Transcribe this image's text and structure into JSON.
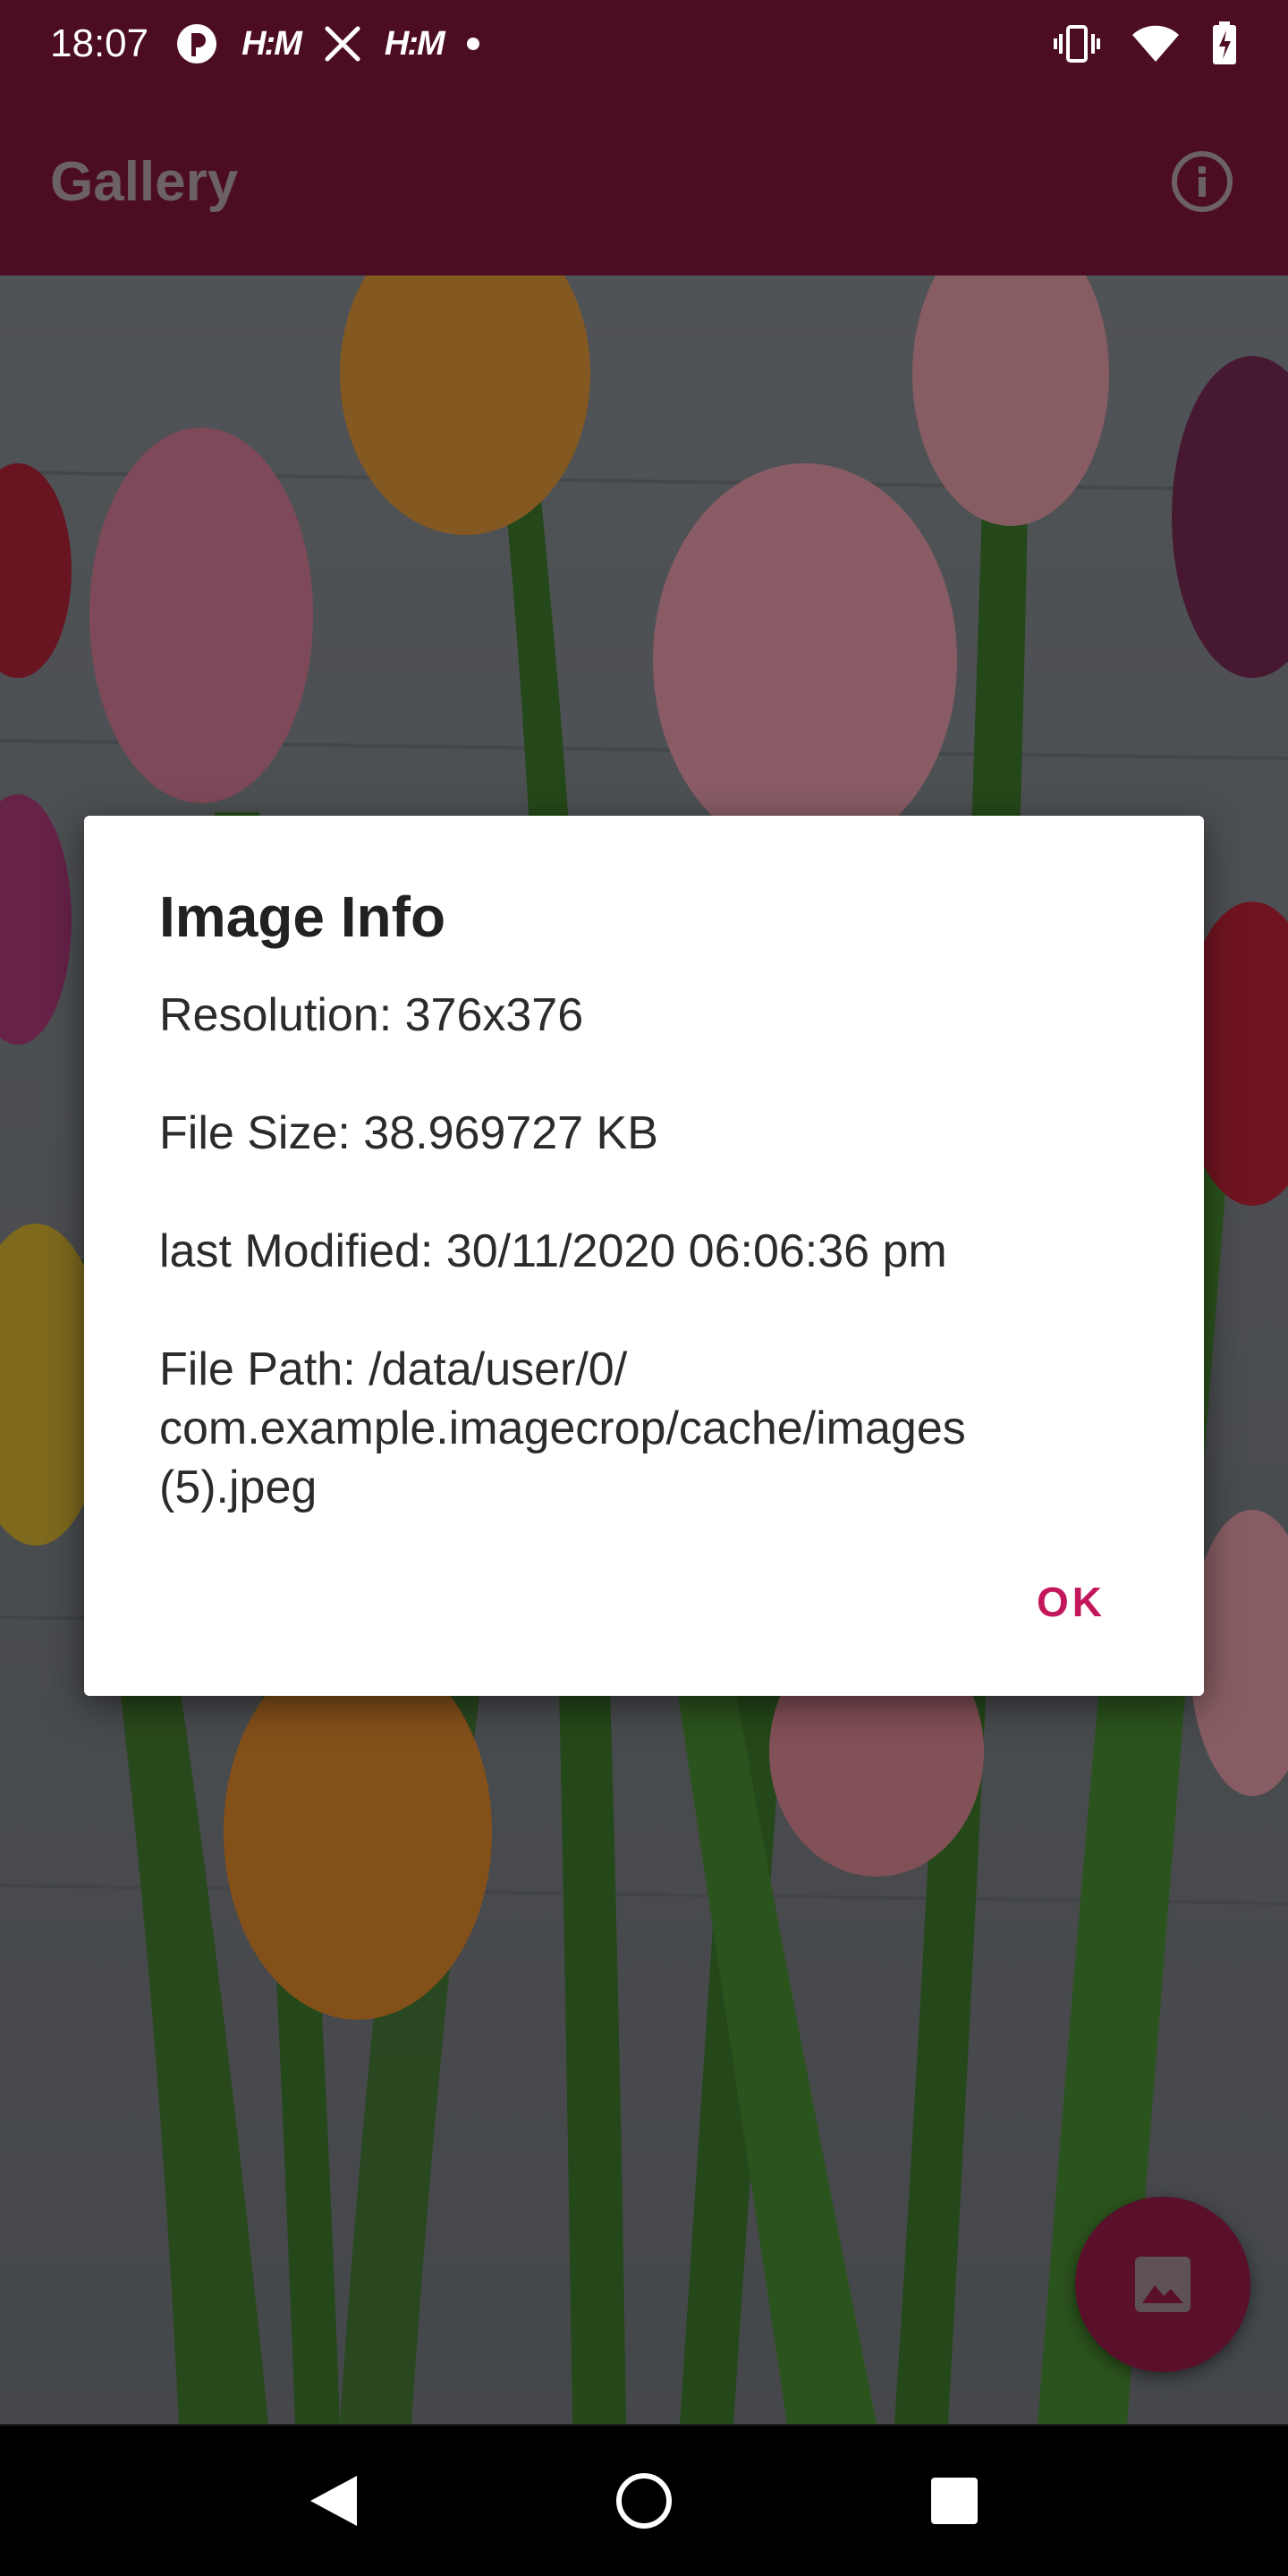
{
  "status_bar": {
    "time": "18:07",
    "notification_icons": [
      "circle-p-icon",
      "hm-icon",
      "scissors-icon",
      "hm-icon",
      "dot-icon"
    ],
    "hm_label": "H:M",
    "right_icons": [
      "vibrate-icon",
      "wifi-icon",
      "battery-charging-icon"
    ]
  },
  "app_bar": {
    "title": "Gallery",
    "info_icon": "info-icon",
    "color": "#4c0d24"
  },
  "dialog": {
    "title": "Image Info",
    "resolution": "Resolution: 376x376",
    "file_size": "File Size: 38.969727 KB",
    "last_modified": "last Modified: 30/11/2020 06:06:36 pm",
    "file_path": "File Path: /data/user/0/\ncom.example.imagecrop/cache/images\n(5).jpeg",
    "ok_label": "OK",
    "accent_color": "#c2185b"
  },
  "fab": {
    "icon": "image-icon",
    "color": "#5a0f2a"
  },
  "nav_bar": {
    "icons": [
      "back-icon",
      "home-icon",
      "recents-icon"
    ]
  }
}
